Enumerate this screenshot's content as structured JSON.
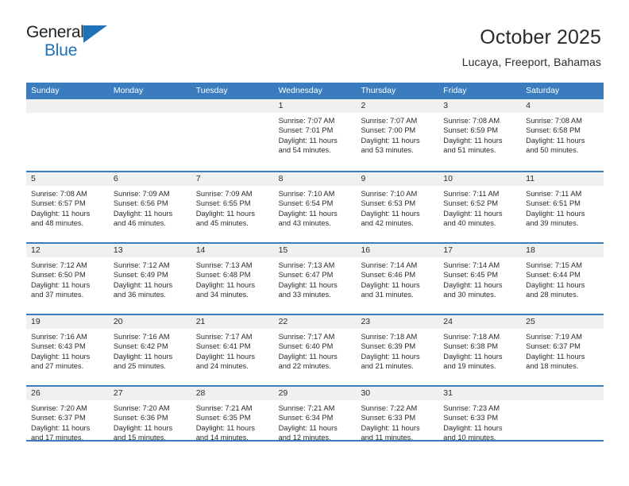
{
  "logo": {
    "word1": "General",
    "word2": "Blue",
    "accent_color": "#1d72b8"
  },
  "header": {
    "title": "October 2025",
    "subtitle": "Lucaya, Freeport, Bahamas"
  },
  "theme": {
    "header_bg": "#3a7cbe",
    "header_text": "#ffffff",
    "daynum_bg": "#f0f0f0",
    "text": "#2b2b2b"
  },
  "weekday_headers": [
    "Sunday",
    "Monday",
    "Tuesday",
    "Wednesday",
    "Thursday",
    "Friday",
    "Saturday"
  ],
  "labels": {
    "sunrise": "Sunrise:",
    "sunset": "Sunset:",
    "daylight": "Daylight:"
  },
  "weeks": [
    [
      {
        "day": "",
        "sunrise": "",
        "sunset": "",
        "daylight1": "",
        "daylight2": ""
      },
      {
        "day": "",
        "sunrise": "",
        "sunset": "",
        "daylight1": "",
        "daylight2": ""
      },
      {
        "day": "",
        "sunrise": "",
        "sunset": "",
        "daylight1": "",
        "daylight2": ""
      },
      {
        "day": "1",
        "sunrise": "Sunrise: 7:07 AM",
        "sunset": "Sunset: 7:01 PM",
        "daylight1": "Daylight: 11 hours",
        "daylight2": "and 54 minutes."
      },
      {
        "day": "2",
        "sunrise": "Sunrise: 7:07 AM",
        "sunset": "Sunset: 7:00 PM",
        "daylight1": "Daylight: 11 hours",
        "daylight2": "and 53 minutes."
      },
      {
        "day": "3",
        "sunrise": "Sunrise: 7:08 AM",
        "sunset": "Sunset: 6:59 PM",
        "daylight1": "Daylight: 11 hours",
        "daylight2": "and 51 minutes."
      },
      {
        "day": "4",
        "sunrise": "Sunrise: 7:08 AM",
        "sunset": "Sunset: 6:58 PM",
        "daylight1": "Daylight: 11 hours",
        "daylight2": "and 50 minutes."
      }
    ],
    [
      {
        "day": "5",
        "sunrise": "Sunrise: 7:08 AM",
        "sunset": "Sunset: 6:57 PM",
        "daylight1": "Daylight: 11 hours",
        "daylight2": "and 48 minutes."
      },
      {
        "day": "6",
        "sunrise": "Sunrise: 7:09 AM",
        "sunset": "Sunset: 6:56 PM",
        "daylight1": "Daylight: 11 hours",
        "daylight2": "and 46 minutes."
      },
      {
        "day": "7",
        "sunrise": "Sunrise: 7:09 AM",
        "sunset": "Sunset: 6:55 PM",
        "daylight1": "Daylight: 11 hours",
        "daylight2": "and 45 minutes."
      },
      {
        "day": "8",
        "sunrise": "Sunrise: 7:10 AM",
        "sunset": "Sunset: 6:54 PM",
        "daylight1": "Daylight: 11 hours",
        "daylight2": "and 43 minutes."
      },
      {
        "day": "9",
        "sunrise": "Sunrise: 7:10 AM",
        "sunset": "Sunset: 6:53 PM",
        "daylight1": "Daylight: 11 hours",
        "daylight2": "and 42 minutes."
      },
      {
        "day": "10",
        "sunrise": "Sunrise: 7:11 AM",
        "sunset": "Sunset: 6:52 PM",
        "daylight1": "Daylight: 11 hours",
        "daylight2": "and 40 minutes."
      },
      {
        "day": "11",
        "sunrise": "Sunrise: 7:11 AM",
        "sunset": "Sunset: 6:51 PM",
        "daylight1": "Daylight: 11 hours",
        "daylight2": "and 39 minutes."
      }
    ],
    [
      {
        "day": "12",
        "sunrise": "Sunrise: 7:12 AM",
        "sunset": "Sunset: 6:50 PM",
        "daylight1": "Daylight: 11 hours",
        "daylight2": "and 37 minutes."
      },
      {
        "day": "13",
        "sunrise": "Sunrise: 7:12 AM",
        "sunset": "Sunset: 6:49 PM",
        "daylight1": "Daylight: 11 hours",
        "daylight2": "and 36 minutes."
      },
      {
        "day": "14",
        "sunrise": "Sunrise: 7:13 AM",
        "sunset": "Sunset: 6:48 PM",
        "daylight1": "Daylight: 11 hours",
        "daylight2": "and 34 minutes."
      },
      {
        "day": "15",
        "sunrise": "Sunrise: 7:13 AM",
        "sunset": "Sunset: 6:47 PM",
        "daylight1": "Daylight: 11 hours",
        "daylight2": "and 33 minutes."
      },
      {
        "day": "16",
        "sunrise": "Sunrise: 7:14 AM",
        "sunset": "Sunset: 6:46 PM",
        "daylight1": "Daylight: 11 hours",
        "daylight2": "and 31 minutes."
      },
      {
        "day": "17",
        "sunrise": "Sunrise: 7:14 AM",
        "sunset": "Sunset: 6:45 PM",
        "daylight1": "Daylight: 11 hours",
        "daylight2": "and 30 minutes."
      },
      {
        "day": "18",
        "sunrise": "Sunrise: 7:15 AM",
        "sunset": "Sunset: 6:44 PM",
        "daylight1": "Daylight: 11 hours",
        "daylight2": "and 28 minutes."
      }
    ],
    [
      {
        "day": "19",
        "sunrise": "Sunrise: 7:16 AM",
        "sunset": "Sunset: 6:43 PM",
        "daylight1": "Daylight: 11 hours",
        "daylight2": "and 27 minutes."
      },
      {
        "day": "20",
        "sunrise": "Sunrise: 7:16 AM",
        "sunset": "Sunset: 6:42 PM",
        "daylight1": "Daylight: 11 hours",
        "daylight2": "and 25 minutes."
      },
      {
        "day": "21",
        "sunrise": "Sunrise: 7:17 AM",
        "sunset": "Sunset: 6:41 PM",
        "daylight1": "Daylight: 11 hours",
        "daylight2": "and 24 minutes."
      },
      {
        "day": "22",
        "sunrise": "Sunrise: 7:17 AM",
        "sunset": "Sunset: 6:40 PM",
        "daylight1": "Daylight: 11 hours",
        "daylight2": "and 22 minutes."
      },
      {
        "day": "23",
        "sunrise": "Sunrise: 7:18 AM",
        "sunset": "Sunset: 6:39 PM",
        "daylight1": "Daylight: 11 hours",
        "daylight2": "and 21 minutes."
      },
      {
        "day": "24",
        "sunrise": "Sunrise: 7:18 AM",
        "sunset": "Sunset: 6:38 PM",
        "daylight1": "Daylight: 11 hours",
        "daylight2": "and 19 minutes."
      },
      {
        "day": "25",
        "sunrise": "Sunrise: 7:19 AM",
        "sunset": "Sunset: 6:37 PM",
        "daylight1": "Daylight: 11 hours",
        "daylight2": "and 18 minutes."
      }
    ],
    [
      {
        "day": "26",
        "sunrise": "Sunrise: 7:20 AM",
        "sunset": "Sunset: 6:37 PM",
        "daylight1": "Daylight: 11 hours",
        "daylight2": "and 17 minutes."
      },
      {
        "day": "27",
        "sunrise": "Sunrise: 7:20 AM",
        "sunset": "Sunset: 6:36 PM",
        "daylight1": "Daylight: 11 hours",
        "daylight2": "and 15 minutes."
      },
      {
        "day": "28",
        "sunrise": "Sunrise: 7:21 AM",
        "sunset": "Sunset: 6:35 PM",
        "daylight1": "Daylight: 11 hours",
        "daylight2": "and 14 minutes."
      },
      {
        "day": "29",
        "sunrise": "Sunrise: 7:21 AM",
        "sunset": "Sunset: 6:34 PM",
        "daylight1": "Daylight: 11 hours",
        "daylight2": "and 12 minutes."
      },
      {
        "day": "30",
        "sunrise": "Sunrise: 7:22 AM",
        "sunset": "Sunset: 6:33 PM",
        "daylight1": "Daylight: 11 hours",
        "daylight2": "and 11 minutes."
      },
      {
        "day": "31",
        "sunrise": "Sunrise: 7:23 AM",
        "sunset": "Sunset: 6:33 PM",
        "daylight1": "Daylight: 11 hours",
        "daylight2": "and 10 minutes."
      },
      {
        "day": "",
        "sunrise": "",
        "sunset": "",
        "daylight1": "",
        "daylight2": ""
      }
    ]
  ]
}
